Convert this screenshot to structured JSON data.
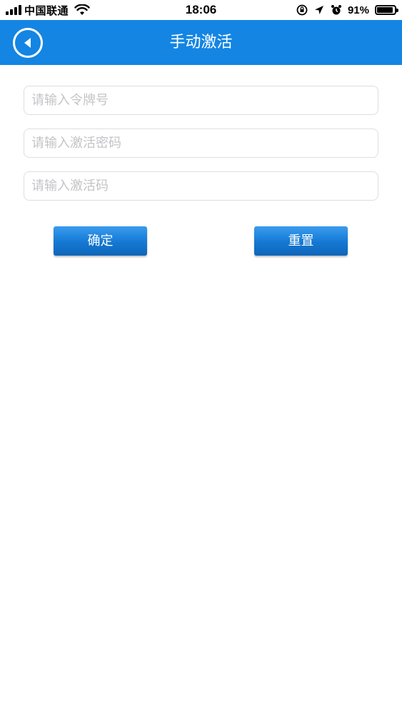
{
  "status_bar": {
    "carrier": "中国联通",
    "time": "18:06",
    "battery_percent": "91%",
    "battery_level": 0.91,
    "icons": [
      "signal-icon",
      "wifi-icon",
      "rotation-lock-icon",
      "location-icon",
      "alarm-icon",
      "battery-icon"
    ]
  },
  "nav": {
    "title": "手动激活",
    "back_icon": "back-arrow-icon",
    "color": "#1485e3"
  },
  "form": {
    "token_placeholder": "请输入令牌号",
    "password_placeholder": "请输入激活密码",
    "code_placeholder": "请输入激活码",
    "token_value": "",
    "password_value": "",
    "code_value": ""
  },
  "buttons": {
    "confirm_label": "确定",
    "reset_label": "重置"
  }
}
